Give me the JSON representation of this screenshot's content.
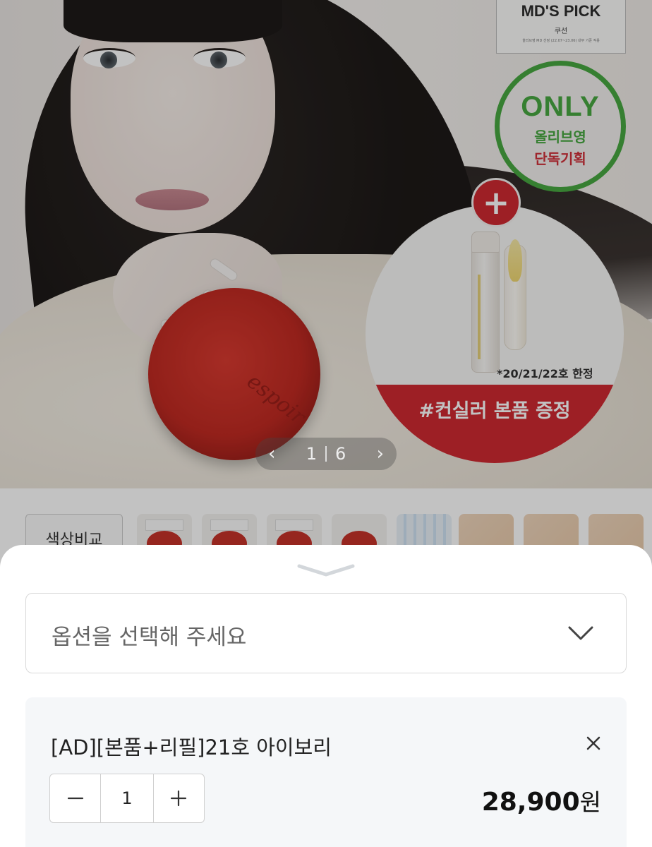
{
  "hero": {
    "badge_md_pick_title": "MD'S PICK",
    "badge_md_pick_sub": "쿠션",
    "badge_md_pick_period": "올리브영 MD 선정 (22.07~23.06) 내부 기준 적용",
    "badge_only": "ONLY",
    "badge_only_line1": "올리브영",
    "badge_only_line2": "단독기획",
    "bonus_note": "*20/21/22호 한정",
    "bonus_banner": "#컨실러 본품 증정",
    "brand_script": "espoir",
    "pager": {
      "current": "1",
      "total": "6"
    }
  },
  "thumbs": {
    "swatch_compare_label": "색상비교"
  },
  "sheet": {
    "option_placeholder": "옵션을 선택해 주세요",
    "selected_item": {
      "name": "[AD][본품+리필]21호 아이보리",
      "quantity": "1",
      "price": "28,900",
      "price_unit": "원"
    }
  },
  "colors": {
    "accent_red": "#cf2a31",
    "accent_green": "#47a841",
    "item_bg": "#f5f7f9"
  },
  "icons": [
    "chevron-left-icon",
    "chevron-right-icon",
    "sheet-handle-icon",
    "chevron-down-icon",
    "close-icon",
    "minus-icon",
    "plus-icon"
  ]
}
